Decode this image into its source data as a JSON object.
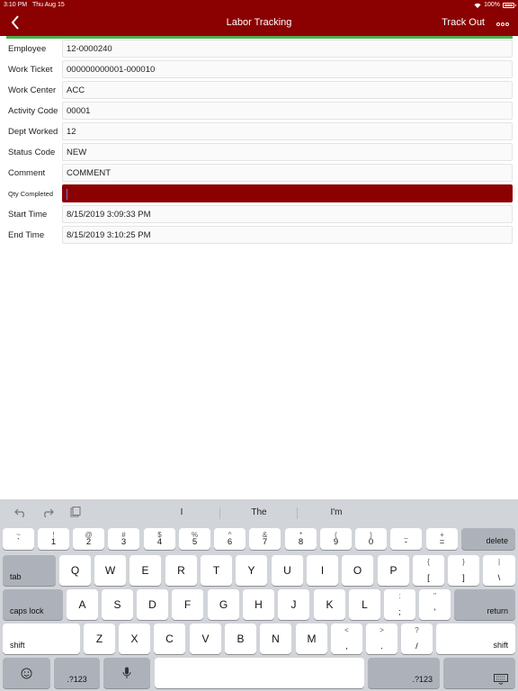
{
  "status": {
    "time": "3:10 PM",
    "date": "Thu Aug 15",
    "battery": "100%"
  },
  "header": {
    "title": "Labor Tracking",
    "action": "Track Out"
  },
  "colors": {
    "brand": "#8b0000",
    "accent": "#4caf50",
    "caret": "#6a7bd8"
  },
  "form": {
    "rows": [
      {
        "label": "Employee",
        "value": "12-0000240"
      },
      {
        "label": "Work Ticket",
        "value": "000000000001-000010"
      },
      {
        "label": "Work Center",
        "value": "ACC"
      },
      {
        "label": "Activity Code",
        "value": "00001"
      },
      {
        "label": "Dept Worked",
        "value": "12"
      },
      {
        "label": "Status Code",
        "value": "NEW"
      },
      {
        "label": "Comment",
        "value": "COMMENT"
      },
      {
        "label": "Qty Completed",
        "value": ""
      },
      {
        "label": "Start Time",
        "value": "8/15/2019 3:09:33 PM"
      },
      {
        "label": "End Time",
        "value": "8/15/2019 3:10:25 PM"
      }
    ]
  },
  "keyboard": {
    "suggestions": [
      "I",
      "The",
      "I'm"
    ],
    "num_row": [
      {
        "top": "~",
        "bottom": "`"
      },
      {
        "top": "!",
        "bottom": "1"
      },
      {
        "top": "@",
        "bottom": "2"
      },
      {
        "top": "#",
        "bottom": "3"
      },
      {
        "top": "$",
        "bottom": "4"
      },
      {
        "top": "%",
        "bottom": "5"
      },
      {
        "top": "^",
        "bottom": "6"
      },
      {
        "top": "&",
        "bottom": "7"
      },
      {
        "top": "*",
        "bottom": "8"
      },
      {
        "top": "(",
        "bottom": "9"
      },
      {
        "top": ")",
        "bottom": "0"
      },
      {
        "top": "_",
        "bottom": "-"
      },
      {
        "top": "+",
        "bottom": "="
      }
    ],
    "delete": "delete",
    "tab": "tab",
    "row_q": [
      "Q",
      "W",
      "E",
      "R",
      "T",
      "Y",
      "U",
      "I",
      "O",
      "P"
    ],
    "bracket_open": {
      "top": "{",
      "bottom": "["
    },
    "bracket_close": {
      "top": "}",
      "bottom": "]"
    },
    "pipe": {
      "top": "|",
      "bottom": "\\"
    },
    "caps": "caps lock",
    "row_a": [
      "A",
      "S",
      "D",
      "F",
      "G",
      "H",
      "J",
      "K",
      "L"
    ],
    "semicolon": {
      "top": ":",
      "bottom": ";"
    },
    "quote": {
      "top": "\"",
      "bottom": "'"
    },
    "return": "return",
    "shift": "shift",
    "row_z": [
      "Z",
      "X",
      "C",
      "V",
      "B",
      "N",
      "M"
    ],
    "comma": {
      "top": "<",
      "bottom": ","
    },
    "period": {
      "top": ">",
      "bottom": "."
    },
    "slash": {
      "top": "?",
      "bottom": "/"
    },
    "numeric": ".?123"
  }
}
